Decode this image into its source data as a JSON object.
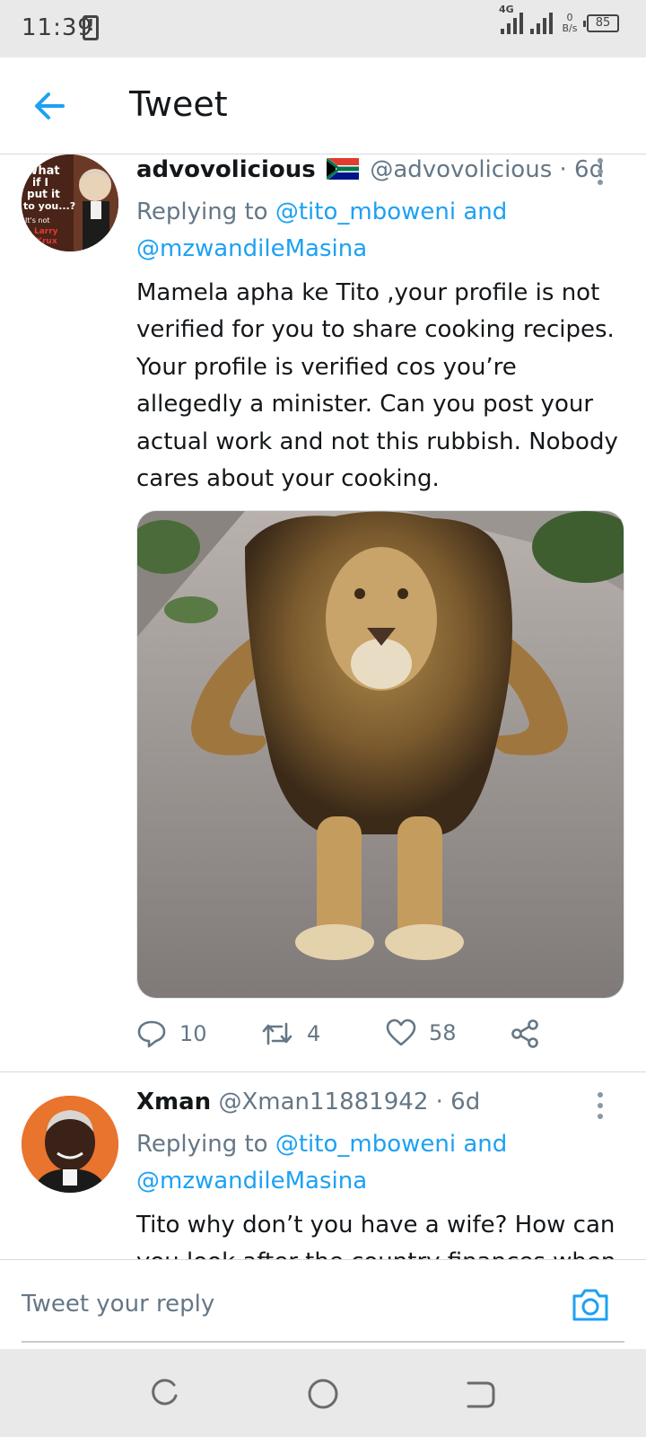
{
  "status_bar": {
    "time": "11:39",
    "network_type": "4G",
    "net_speed_value": "0",
    "net_speed_unit": "B/s",
    "battery": "85"
  },
  "header": {
    "title": "Tweet"
  },
  "tweets": [
    {
      "display_name": "advovolicious",
      "handle": "@advovolicious",
      "time": "· 6d",
      "replying_prefix": "Replying to",
      "replying_to_1": "@tito_mboweni",
      "replying_conj": "and",
      "replying_to_2": "@mzwandileMasina",
      "text": "Mamela apha ke Tito ,your profile is not verified for you to share cooking recipes. Your profile is verified cos you’re allegedly a minister. Can you post your actual work and not this rubbish. Nobody cares about your cooking.",
      "avatar_lines": [
        "What",
        "if I",
        "put it",
        "to you...?",
        "It's not",
        "Larry",
        "Krux"
      ],
      "replies": "10",
      "retweets": "4",
      "likes": "58"
    },
    {
      "display_name": "Xman",
      "handle": "@Xman11881942",
      "time": "· 6d",
      "replying_prefix": "Replying to",
      "replying_to_1": "@tito_mboweni",
      "replying_conj": "and",
      "replying_to_2": "@mzwandileMasina",
      "text": "Tito why don’t you have a wife? How can you look after the country finances when you"
    }
  ],
  "reply_bar": {
    "placeholder": "Tweet your reply"
  },
  "colors": {
    "accent": "#1da1f2",
    "muted": "#657786",
    "text": "#14171a",
    "system_bar": "#e9e9ea"
  },
  "icons": [
    "back-arrow-icon",
    "kebab-menu-icon",
    "reply-icon",
    "retweet-icon",
    "like-icon",
    "share-icon",
    "camera-icon",
    "recent-apps-icon",
    "home-icon",
    "back-nav-icon"
  ]
}
